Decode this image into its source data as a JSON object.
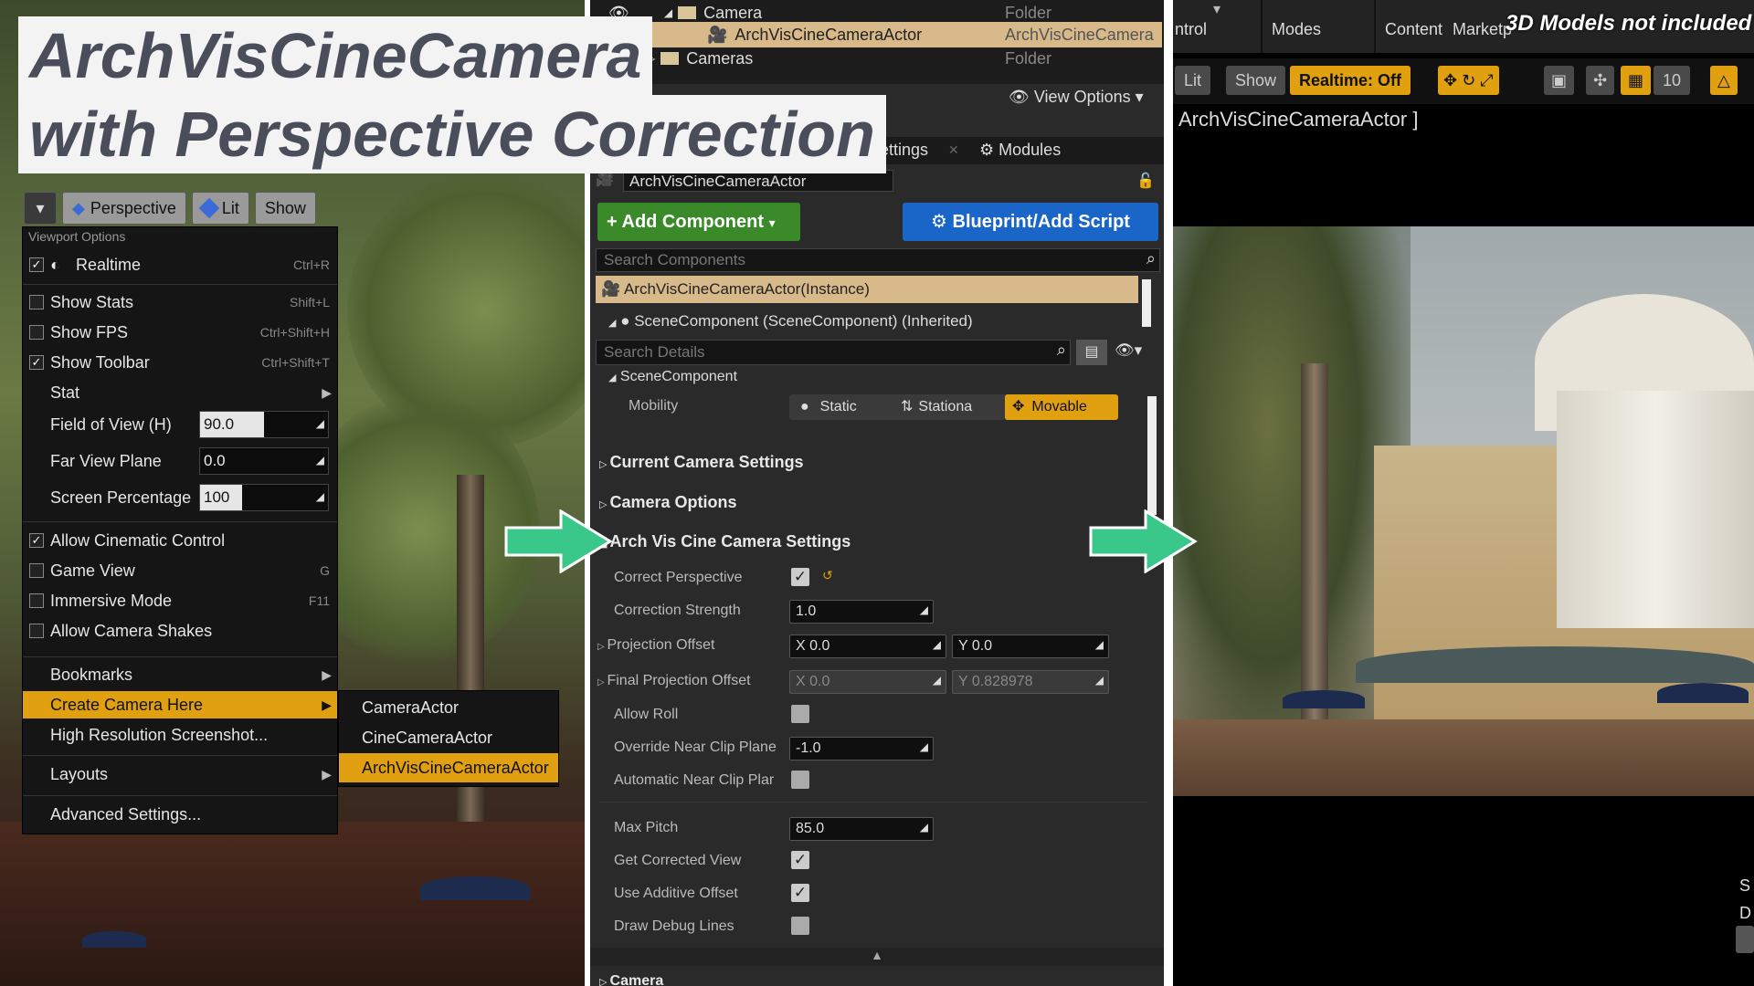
{
  "title": {
    "line1": "ArchVisCineCamera",
    "line2": "with Perspective Correction"
  },
  "viewport_toolbar": {
    "perspective": "Perspective",
    "lit": "Lit",
    "show": "Show"
  },
  "viewport_menu": {
    "header": "Viewport Options",
    "realtime": {
      "label": "Realtime",
      "shortcut": "Ctrl+R",
      "checked": true
    },
    "show_stats": {
      "label": "Show Stats",
      "shortcut": "Shift+L",
      "checked": false
    },
    "show_fps": {
      "label": "Show FPS",
      "shortcut": "Ctrl+Shift+H",
      "checked": false
    },
    "show_toolbar": {
      "label": "Show Toolbar",
      "shortcut": "Ctrl+Shift+T",
      "checked": true
    },
    "stat": "Stat",
    "fov": {
      "label": "Field of View (H)",
      "value": "90.0"
    },
    "far_view_plane": {
      "label": "Far View Plane",
      "value": "0.0"
    },
    "screen_percentage": {
      "label": "Screen Percentage",
      "value": "100"
    },
    "allow_cinematic_control": {
      "label": "Allow Cinematic Control",
      "checked": true
    },
    "game_view": {
      "label": "Game View",
      "shortcut": "G",
      "checked": false
    },
    "immersive_mode": {
      "label": "Immersive Mode",
      "shortcut": "F11",
      "checked": false
    },
    "allow_camera_shakes": {
      "label": "Allow Camera Shakes",
      "checked": false
    },
    "bookmarks": "Bookmarks",
    "create_camera_here": "Create Camera Here",
    "high_res_screenshot": "High Resolution Screenshot...",
    "layouts": "Layouts",
    "advanced_settings": "Advanced Settings..."
  },
  "create_camera_submenu": [
    "CameraActor",
    "CineCameraActor",
    "ArchVisCineCameraActor"
  ],
  "outliner": {
    "rows": [
      {
        "name": "Camera",
        "type": "Folder"
      },
      {
        "name": "ArchVisCineCameraActor",
        "type": "ArchVisCineCamera"
      },
      {
        "name": "Cameras",
        "type": "Folder"
      }
    ],
    "view_options": "View Options"
  },
  "details_tabs": {
    "world_settings": "d Settings",
    "modules": "Modules"
  },
  "details": {
    "actor_name": "ArchVisCineCameraActor",
    "add_component": "+ Add Component",
    "blueprint": "Blueprint/Add Script",
    "search_components": "Search Components",
    "instance": "ArchVisCineCameraActor(Instance)",
    "scene_component_inherited": "SceneComponent (SceneComponent) (Inherited)",
    "search_details": "Search Details",
    "scene_component": "SceneComponent",
    "mobility": {
      "label": "Mobility",
      "static": "Static",
      "stationary": "Stationa",
      "movable": "Movable"
    },
    "current_camera_settings": "Current Camera Settings",
    "camera_options": "Camera Options",
    "archvis_section": "Arch Vis Cine Camera Settings",
    "correct_perspective": {
      "label": "Correct Perspective",
      "checked": true
    },
    "correction_strength": {
      "label": "Correction Strength",
      "value": "1.0"
    },
    "projection_offset": {
      "label": "Projection Offset",
      "x": "0.0",
      "y": "0.0"
    },
    "final_projection_offset": {
      "label": "Final Projection Offset",
      "x": "0.0",
      "y": "0.828978"
    },
    "allow_roll": {
      "label": "Allow Roll",
      "checked": false
    },
    "override_near_clip": {
      "label": "Override Near Clip Plane",
      "value": "-1.0"
    },
    "auto_near_clip": {
      "label": "Automatic Near Clip Plar",
      "checked": false
    },
    "max_pitch": {
      "label": "Max Pitch",
      "value": "85.0"
    },
    "get_corrected_view": {
      "label": "Get Corrected View",
      "checked": true
    },
    "use_additive_offset": {
      "label": "Use Additive Offset",
      "checked": true
    },
    "draw_debug_lines": {
      "label": "Draw Debug Lines",
      "checked": false
    },
    "camera_section": "Camera"
  },
  "right_toolbar": {
    "control_label": "ntrol",
    "modes": "Modes",
    "content": "Content",
    "marketplace": "Marketp",
    "watermark": "3D Models not included",
    "lit": "Lit",
    "show": "Show",
    "realtime": "Realtime: Off",
    "grid_value": "10",
    "viewport_title": "ArchVisCineCameraActor ]"
  },
  "colors": {
    "accent_orange": "#e0a010",
    "highlight_row": "#d8b98a",
    "add_component_green": "#3a8a2a",
    "blueprint_blue": "#1a66c8",
    "arrow_green": "#3ac88a"
  }
}
